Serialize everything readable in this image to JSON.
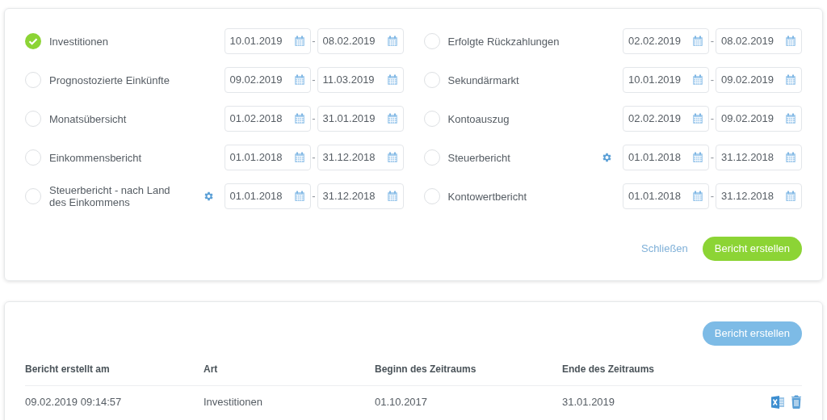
{
  "report_types": [
    {
      "label": "Investitionen",
      "selected": true,
      "settings": false,
      "from": "10.01.2019",
      "to": "08.02.2019"
    },
    {
      "label": "Erfolgte Rückzahlungen",
      "selected": false,
      "settings": false,
      "from": "02.02.2019",
      "to": "08.02.2019"
    },
    {
      "label": "Prognostozierte Einkünfte",
      "selected": false,
      "settings": false,
      "from": "09.02.2019",
      "to": "11.03.2019"
    },
    {
      "label": "Sekundärmarkt",
      "selected": false,
      "settings": false,
      "from": "10.01.2019",
      "to": "09.02.2019"
    },
    {
      "label": "Monatsübersicht",
      "selected": false,
      "settings": false,
      "from": "01.02.2018",
      "to": "31.01.2019"
    },
    {
      "label": "Kontoauszug",
      "selected": false,
      "settings": false,
      "from": "02.02.2019",
      "to": "09.02.2019"
    },
    {
      "label": "Einkommensbericht",
      "selected": false,
      "settings": false,
      "from": "01.01.2018",
      "to": "31.12.2018"
    },
    {
      "label": "Steuerbericht",
      "selected": false,
      "settings": true,
      "from": "01.01.2018",
      "to": "31.12.2018"
    },
    {
      "label": "Steuerbericht - nach Land des Einkommens",
      "selected": false,
      "settings": true,
      "from": "01.01.2018",
      "to": "31.12.2018"
    },
    {
      "label": "Kontowertbericht",
      "selected": false,
      "settings": false,
      "from": "01.01.2018",
      "to": "31.12.2018"
    }
  ],
  "range_separator": "-",
  "close_link": "Schließen",
  "create_button": {
    "label": "Bericht erstellen",
    "disabled": false
  },
  "history": {
    "create_button": {
      "label": "Bericht erstellen",
      "disabled": true
    },
    "columns": [
      "Bericht erstellt am",
      "Art",
      "Beginn des Zeitraums",
      "Ende des Zeitraums"
    ],
    "rows": [
      {
        "cells": [
          "09.02.2019 09:14:57",
          "Investitionen",
          "01.10.2017",
          "31.01.2019"
        ]
      }
    ]
  }
}
